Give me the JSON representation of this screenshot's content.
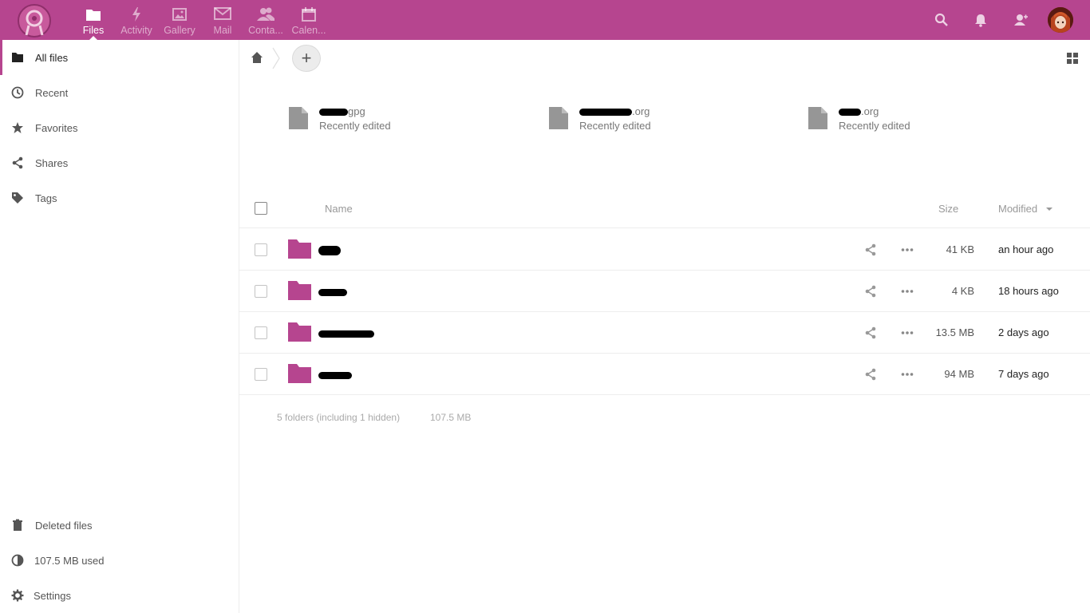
{
  "header": {
    "apps": [
      {
        "label": "Files",
        "icon": "folder-icon",
        "active": true
      },
      {
        "label": "Activity",
        "icon": "lightning-icon",
        "active": false
      },
      {
        "label": "Gallery",
        "icon": "image-icon",
        "active": false
      },
      {
        "label": "Mail",
        "icon": "mail-icon",
        "active": false
      },
      {
        "label": "Conta...",
        "icon": "contacts-icon",
        "active": false
      },
      {
        "label": "Calen...",
        "icon": "calendar-icon",
        "active": false
      }
    ],
    "right_icons": [
      "search-icon",
      "notifications-icon",
      "contacts-menu-icon",
      "avatar"
    ],
    "brand_color": "#b6458f"
  },
  "sidebar": {
    "items": [
      {
        "label": "All files",
        "icon": "folder-icon"
      },
      {
        "label": "Recent",
        "icon": "clock-icon"
      },
      {
        "label": "Favorites",
        "icon": "star-icon"
      },
      {
        "label": "Shares",
        "icon": "share-icon"
      },
      {
        "label": "Tags",
        "icon": "tag-icon"
      }
    ],
    "footer": [
      {
        "label": "Deleted files",
        "icon": "trash-icon"
      },
      {
        "label": "107.5 MB used",
        "icon": "quota-icon"
      },
      {
        "label": "Settings",
        "icon": "gear-icon"
      }
    ]
  },
  "toolbar": {
    "add_label": "+"
  },
  "recent_files": [
    {
      "name_visible": "gpg",
      "subtitle": "Recently edited"
    },
    {
      "name_visible": ".org",
      "subtitle": "Recently edited"
    },
    {
      "name_visible": ".org",
      "subtitle": "Recently edited"
    }
  ],
  "table": {
    "columns": {
      "name": "Name",
      "size": "Size",
      "modified": "Modified"
    },
    "rows": [
      {
        "size": "41 KB",
        "modified": "an hour ago"
      },
      {
        "size": "4 KB",
        "modified": "18 hours ago"
      },
      {
        "size": "13.5 MB",
        "modified": "2 days ago"
      },
      {
        "size": "94 MB",
        "modified": "7 days ago"
      }
    ],
    "summary": {
      "count": "5 folders (including 1 hidden)",
      "total": "107.5 MB"
    }
  }
}
